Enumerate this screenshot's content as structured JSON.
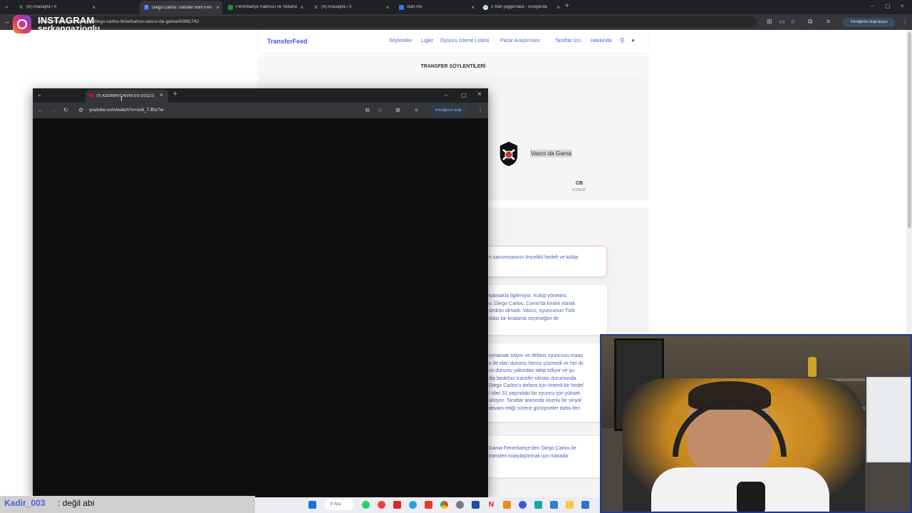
{
  "browser": {
    "tabs": [
      {
        "label": "(9) Anasayfa / X",
        "icon": "x-icon",
        "active": false
      },
      {
        "label": "Diego Carlos Transfer from Fen",
        "icon": "transferfeed-favicon",
        "active": true
      },
      {
        "label": "Fenerbahçe Kadrosu ve Yaband",
        "icon": "sheet-favicon",
        "active": false
      },
      {
        "label": "(9) Anasayfa / X",
        "icon": "x-icon",
        "active": false
      },
      {
        "label": "start.me",
        "icon": "startme-favicon",
        "active": false
      },
      {
        "label": "x man juggernaut - Google'da",
        "icon": "google-icon",
        "active": false
      }
    ],
    "url": "transferfeed.com/transfers/diego-carlos-fenerbahce-vasco-da-gama/43981742",
    "verify_label": "Kimliğinizi doğrulayın"
  },
  "overlay": {
    "instagram_title": "INSTAGRAM",
    "instagram_user": "serkangazioglu"
  },
  "site": {
    "logo": "TransferFeed",
    "nav": [
      "Söylentiler",
      "Ligler",
      "Oyuncu İzleme Listesi",
      "Pazar Araştırması",
      "Taraftar İzci",
      "Hakkında"
    ],
    "section_title": "TRANSFER SÖYLENTİLERİ",
    "club_name": "Vasco da Gama",
    "position_value": "CB",
    "position_label": "KONUM",
    "notes": [
      [
        "n savunmasının öncelikli hedefi ve kulüp"
      ],
      [
        "katmakla ilgileniyor. Kulüp yönetimi,",
        "u. Diego Carlos, Como'da kiralık olarak",
        "ümkün olmadı. Vasco, oyuncunun Türk",
        "olası bir kiralama seçeneğini de"
      ],
      [
        "oynamak istiyor ve defans oyuncusu maaş",
        "e ile olan durumu henüz çözmedi ve her iki",
        "co durumu yakından takip ediyor ve şu",
        "dip bedelsiz transfer olması durumunda",
        "Diego Carlos'u defans için önemli bir hedef",
        "i olan 31 yaşındaki bir oyuncu için yüksek",
        "ünüyor. Taraftar arasında olumlu bir sinyal",
        "devam ettiği sürece görüşmeler daha ileri"
      ],
      [
        "Gama Fenerbahçe'den Diego Carlos ile",
        "transferi kolaylaştırmak için masada"
      ]
    ]
  },
  "popup": {
    "tab_label": "(7) AZERBAYCAN'IN EN GÜÇLÜ",
    "url": "youtube.com/watch?v=sn8_TJlhz7w",
    "verify_label": "Kimliğinizi doğr..."
  },
  "chat": {
    "user": "Kadir_003",
    "message": ": değil abi"
  },
  "taskbar": {
    "search_label": "Ara"
  },
  "colors": {
    "accent": "#3a5bd9",
    "chrome_dark": "#202124",
    "webcam_border": "#1f3a8f"
  }
}
